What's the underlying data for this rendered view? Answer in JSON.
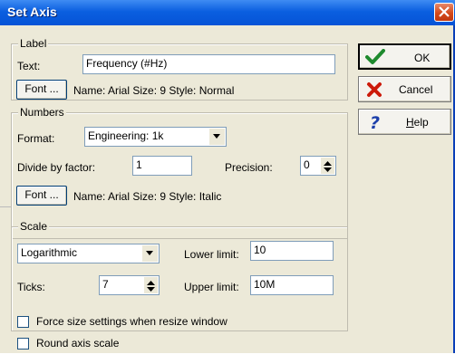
{
  "window": {
    "title": "Set Axis"
  },
  "label_group": {
    "legend": "Label",
    "text_label": "Text:",
    "text_value": "Frequency (#Hz)",
    "font_button": "Font ...",
    "font_info": "Name: Arial Size: 9 Style: Normal"
  },
  "numbers_group": {
    "legend": "Numbers",
    "format_label": "Format:",
    "format_value": "Engineering: 1k",
    "divide_label": "Divide by factor:",
    "divide_value": "1",
    "precision_label": "Precision:",
    "precision_value": "0",
    "font_button": "Font ...",
    "font_info": "Name: Arial Size: 9 Style: Italic"
  },
  "scale_group": {
    "legend": "Scale",
    "scale_type": "Logarithmic",
    "ticks_label": "Ticks:",
    "ticks_value": "7",
    "lower_label": "Lower limit:",
    "lower_value": "10",
    "upper_label": "Upper limit:",
    "upper_value": "10M"
  },
  "options": {
    "force_size": {
      "label": "Force size settings when resize window",
      "checked": false
    },
    "round_axis": {
      "label": "Round axis scale",
      "checked": false
    }
  },
  "buttons": {
    "ok": "OK",
    "cancel": "Cancel",
    "help": "Help"
  },
  "icons": {
    "ok": "checkmark-icon",
    "cancel": "red-x-icon",
    "help": "question-mark-icon",
    "close": "close-icon"
  },
  "colors": {
    "title_bar": "#0b5fe0",
    "dialog_bg": "#ece9d8",
    "ok_icon": "#1e8a2e",
    "cancel_icon": "#cc1a0a",
    "help_icon": "#1c3faa"
  }
}
